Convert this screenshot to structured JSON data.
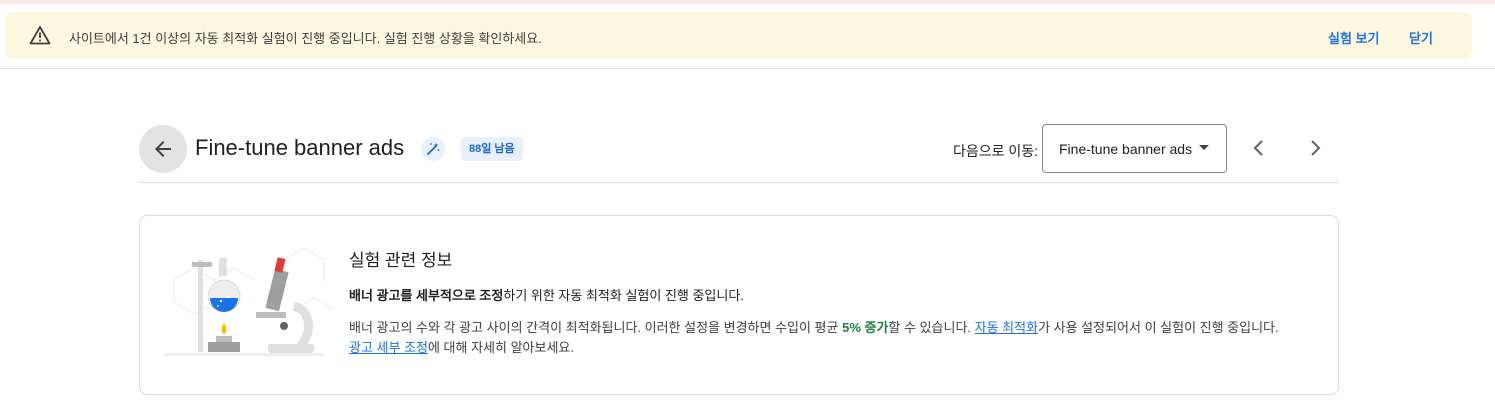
{
  "banner": {
    "message": "사이트에서 1건 이상의 자동 최적화 실험이 진행 중입니다. 실험 진행 상황을 확인하세요.",
    "view_label": "실험 보기",
    "close_label": "닫기",
    "icon": "warning-icon"
  },
  "header": {
    "title": "Fine-tune banner ads",
    "days_badge": "88일 남음",
    "goto_label": "다음으로 이동:",
    "goto_value": "Fine-tune banner ads"
  },
  "card": {
    "title": "실험 관련 정보",
    "line1_bold": "배너 광고를 세부적으로 조정",
    "line1_rest": "하기 위한 자동 최적화 실험이 진행 중입니다.",
    "para_part1": "배너 광고의 수와 각 광고 사이의 간격이 최적화됩니다. 이러한 설정을 변경하면 수입이 평균 ",
    "para_highlight": "5% 증가",
    "para_part2": "할 수 있습니다. ",
    "link_auto": "자동 최적화",
    "para_part3": "가 사용 설정되어서 이 실험이 진행 중입니다.",
    "link_finetune": "광고 세부 조정",
    "para_part4": "에 대해 자세히 알아보세요."
  },
  "colors": {
    "accent": "#1a73e8",
    "banner_bg": "#fef7e0",
    "success": "#188038"
  }
}
